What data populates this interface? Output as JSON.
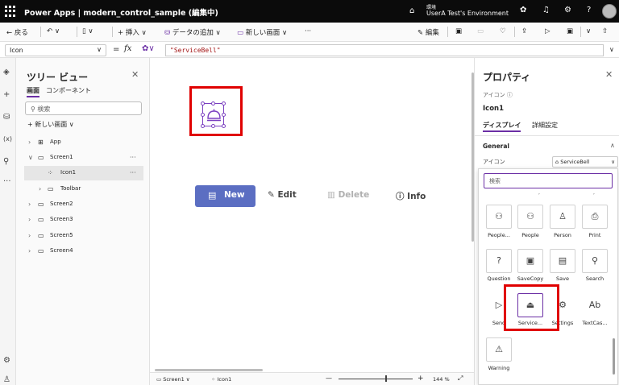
{
  "topbar": {
    "title": "Power Apps  |  modern_control_sample (編集中)",
    "env_label": "環境",
    "env_name": "UserA Test's Environment",
    "icons": [
      "waffle-icon",
      "environment-icon",
      "copilot-icon",
      "bell-icon",
      "gear-icon",
      "help-icon",
      "avatar"
    ]
  },
  "cmdbar": {
    "back": "戻る",
    "insert": "挿入",
    "add_data": "データの追加",
    "new_screen": "新しい画面",
    "more": "···",
    "edit": "編集"
  },
  "formula_bar": {
    "property": "Icon",
    "eq": "=",
    "fx": "fx",
    "formula": "\"ServiceBell\""
  },
  "tree": {
    "title": "ツリー ビュー",
    "tabs": [
      "画面",
      "コンポーネント"
    ],
    "search_placeholder": "検索",
    "new_screen": "新しい画面",
    "items": [
      {
        "label": "App",
        "icon": "app-icon"
      },
      {
        "label": "Screen1",
        "icon": "screen-icon",
        "more": "···"
      },
      {
        "label": "Icon1",
        "icon": "icon-control-icon",
        "more": "···"
      },
      {
        "label": "Toolbar",
        "icon": "toolbar-icon"
      },
      {
        "label": "Screen2",
        "icon": "screen-icon"
      },
      {
        "label": "Screen3",
        "icon": "screen-icon"
      },
      {
        "label": "Screen5",
        "icon": "screen-icon"
      },
      {
        "label": "Screen4",
        "icon": "screen-icon"
      }
    ]
  },
  "canvas": {
    "toolbar": {
      "new": "New",
      "edit": "Edit",
      "delete": "Delete",
      "info": "Info"
    }
  },
  "statusbar": {
    "screen": "Screen1",
    "control": "Icon1",
    "minus": "—",
    "plus": "+",
    "zoom": "144 %"
  },
  "props": {
    "title": "プロパティ",
    "type_label": "アイコン",
    "name": "Icon1",
    "tabs": [
      "ディスプレイ",
      "詳細設定"
    ],
    "section": "General",
    "icon_label": "アイコン",
    "icon_value": "ServiceBell"
  },
  "picker": {
    "search_placeholder": "検索",
    "items": [
      {
        "label": "People...",
        "glyph": "people-add-icon"
      },
      {
        "label": "People",
        "glyph": "people-icon"
      },
      {
        "label": "Person",
        "glyph": "person-icon"
      },
      {
        "label": "Print",
        "glyph": "print-icon"
      },
      {
        "label": "Question",
        "glyph": "question-icon"
      },
      {
        "label": "SaveCopy",
        "glyph": "save-copy-icon"
      },
      {
        "label": "Save",
        "glyph": "save-icon"
      },
      {
        "label": "Search",
        "glyph": "search-icon"
      },
      {
        "label": "Send",
        "glyph": "send-icon"
      },
      {
        "label": "Service...",
        "glyph": "service-bell-icon"
      },
      {
        "label": "Settings",
        "glyph": "settings-icon"
      },
      {
        "label": "TextCas...",
        "glyph": "text-case-icon"
      },
      {
        "label": "Warning",
        "glyph": "warning-icon"
      }
    ]
  },
  "colors": {
    "accent": "#6b2fa5",
    "highlight": "#e00000",
    "primary_button": "#5b6ec2"
  }
}
